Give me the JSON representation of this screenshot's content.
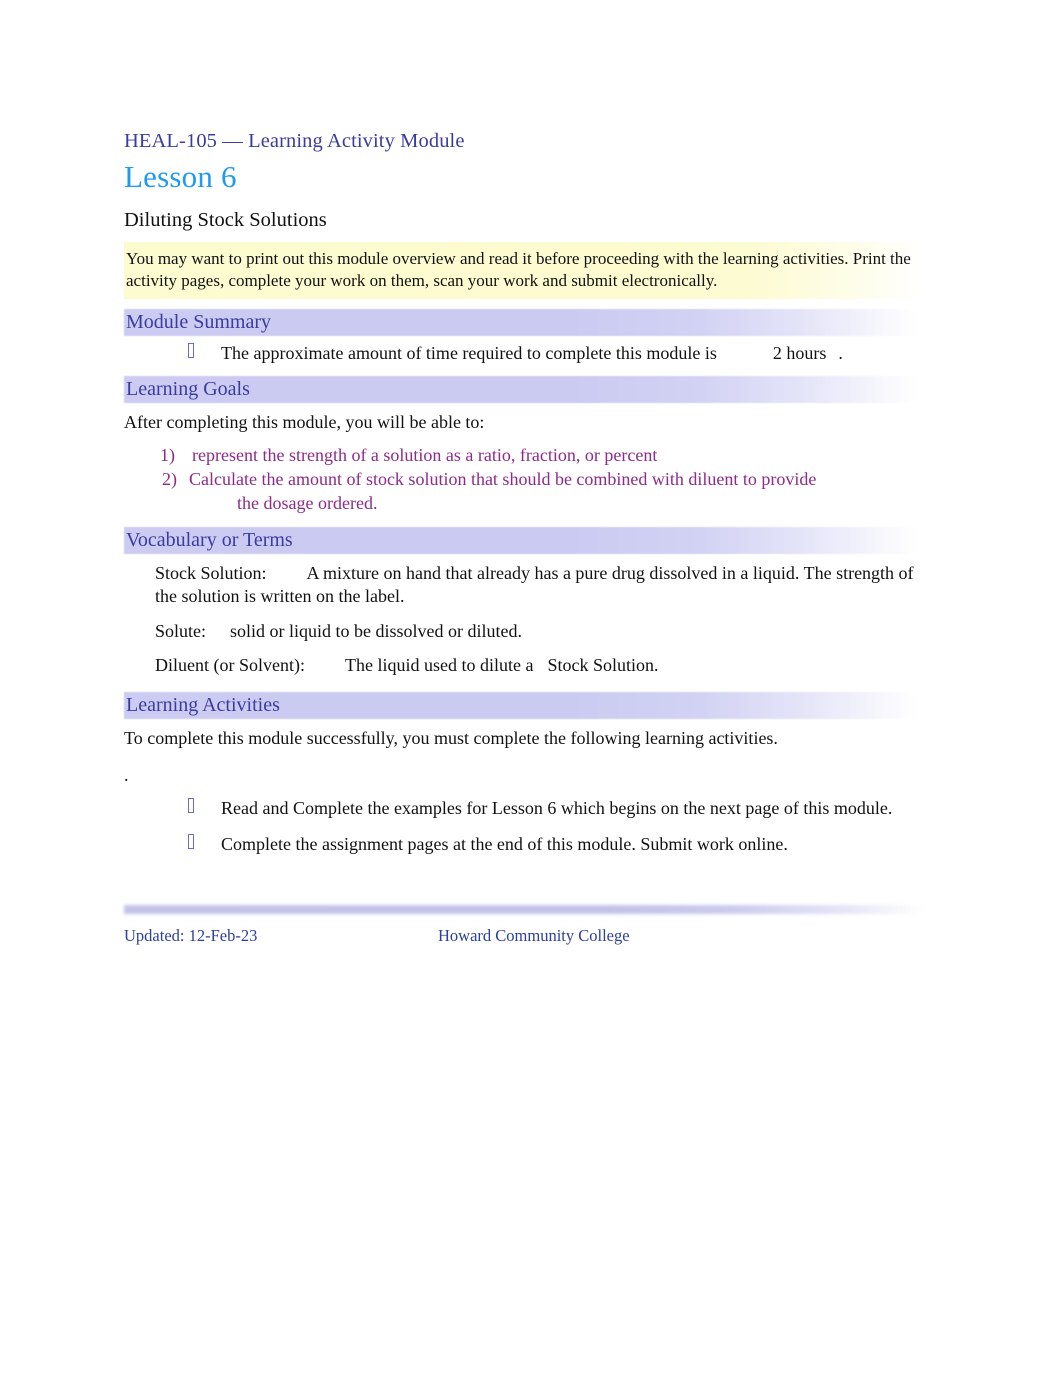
{
  "header": {
    "course_line": "HEAL-105 — Learning Activity Module",
    "lesson_title": "Lesson 6",
    "subtitle": "Diluting Stock Solutions"
  },
  "note_box": {
    "text": "You may want to print out this module overview and read it before proceeding with the learning activities. Print the activity pages, complete your work on them, scan your work and submit electronically."
  },
  "sections": {
    "module_summary": {
      "heading": "Module Summary",
      "item_prefix": "The approximate amount of time required to complete this module is",
      "duration_value": "2 hours",
      "item_suffix": "."
    },
    "learning_goals": {
      "heading": "Learning Goals",
      "intro": "After completing this module, you will be able to:",
      "goals": [
        {
          "number": "1)",
          "text": "represent the strength of a solution as a ratio, fraction, or percent"
        },
        {
          "number": "2)",
          "text": "Calculate the amount of stock solution that should be combined with diluent to provide",
          "continuation": "the dosage ordered."
        }
      ]
    },
    "vocabulary": {
      "heading": "Vocabulary or Terms",
      "entries": [
        {
          "term": "Stock Solution:",
          "definition": "A mixture on hand that already has a pure drug dissolved in a liquid. The strength of the solution is written on the label."
        },
        {
          "term": "Solute:",
          "definition": "solid or liquid to be dissolved or diluted."
        },
        {
          "term": "Diluent (or Solvent):",
          "definition_part1": "The liquid used to dilute a",
          "definition_part2": "Stock Solution."
        }
      ]
    },
    "learning_activities": {
      "heading": "Learning Activities",
      "intro": "To complete this module successfully, you must complete the following learning activities.",
      "stray_mark": ".",
      "activities": [
        "Read and Complete the examples for Lesson 6 which begins on the next page of this module.",
        "Complete the assignment pages at the end of this module. Submit work online."
      ]
    }
  },
  "footer": {
    "updated": "Updated: 12-Feb-23",
    "organization": "Howard Community College"
  },
  "colors": {
    "course_heading": "#3b3ba0",
    "lesson_title": "#1e9bf0",
    "section_bar": "#ccccf2",
    "goal_text": "#8e2a8b",
    "note_box": "#fdfbd0",
    "footer_text": "#2b3f9e"
  },
  "icons": {
    "bullet": "tofu-box-glyph"
  }
}
